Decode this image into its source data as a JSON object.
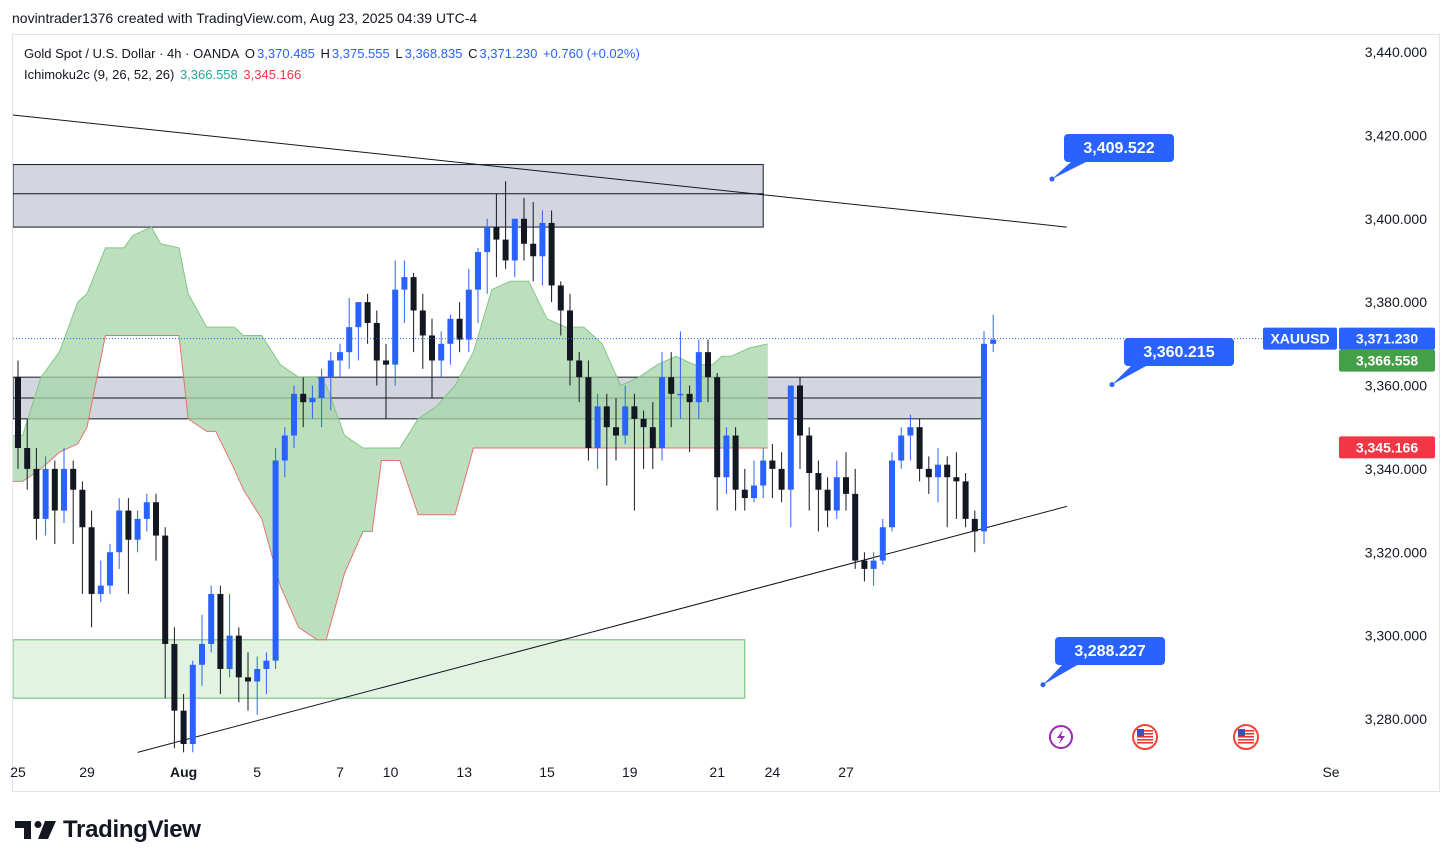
{
  "credit": "novintrader1376 created with TradingView.com, Aug 23, 2025 04:39 UTC-4",
  "legend": {
    "symbol": "Gold Spot / U.S. Dollar · 4h · OANDA",
    "o_label": "O",
    "o": "3,370.485",
    "h_label": "H",
    "h": "3,375.555",
    "l_label": "L",
    "l": "3,368.835",
    "c_label": "C",
    "c": "3,371.230",
    "change": "+0.760 (+0.02%)",
    "indicator": "Ichimoku2c (9, 26, 52, 26)",
    "ind_v1": "3,366.558",
    "ind_v2": "3,345.166"
  },
  "brand": "TradingView",
  "colors": {
    "up": "#2962ff",
    "down": "#131722",
    "cloud": "#a5d6a7",
    "cloud_edge": "#e57373",
    "grey_zone": "#d1d4dc",
    "green_zone": "#e2f3e2",
    "callout": "#2962ff",
    "price_tag": "#2962ff",
    "ind_green": "#43a047",
    "ind_red": "#f23645"
  },
  "chart_data": {
    "type": "candlestick",
    "timeframe": "4h",
    "y_axis": {
      "min": 3268,
      "max": 3444,
      "ticks": [
        "3,440.000",
        "3,420.000",
        "3,400.000",
        "3,380.000",
        "3,360.000",
        "3,340.000",
        "3,320.000",
        "3,300.000",
        "3,280.000"
      ],
      "tick_values": [
        3440,
        3420,
        3400,
        3380,
        3360,
        3340,
        3320,
        3300,
        3280
      ]
    },
    "x_axis": {
      "labels": [
        "25",
        "29",
        "Aug",
        "5",
        "7",
        "10",
        "13",
        "15",
        "19",
        "21",
        "24",
        "27",
        "Se"
      ],
      "label_index": [
        0,
        7.5,
        18,
        26,
        35,
        40.5,
        48.5,
        57.5,
        66.5,
        76,
        82,
        90,
        98
      ]
    },
    "x_range": [
      0,
      99
    ],
    "ohlc": [
      [
        3362,
        3366,
        3340,
        3345
      ],
      [
        3345,
        3352,
        3335,
        3340
      ],
      [
        3340,
        3345,
        3323,
        3328
      ],
      [
        3328,
        3343,
        3324,
        3340
      ],
      [
        3340,
        3342,
        3322,
        3330
      ],
      [
        3330,
        3345,
        3327,
        3340
      ],
      [
        3340,
        3342,
        3322,
        3335
      ],
      [
        3335,
        3337,
        3310,
        3326
      ],
      [
        3326,
        3330,
        3302,
        3310
      ],
      [
        3310,
        3318,
        3308,
        3312
      ],
      [
        3312,
        3322,
        3310,
        3320
      ],
      [
        3320,
        3333,
        3316,
        3330
      ],
      [
        3330,
        3333,
        3310,
        3323
      ],
      [
        3323,
        3330,
        3320,
        3328
      ],
      [
        3328,
        3334,
        3325,
        3332
      ],
      [
        3332,
        3334,
        3318,
        3324
      ],
      [
        3324,
        3326,
        3285,
        3298
      ],
      [
        3298,
        3302,
        3273,
        3282
      ],
      [
        3282,
        3286,
        3272,
        3274
      ],
      [
        3274,
        3294,
        3272,
        3293
      ],
      [
        3293,
        3305,
        3288,
        3298
      ],
      [
        3298,
        3312,
        3296,
        3310
      ],
      [
        3310,
        3312,
        3286,
        3292
      ],
      [
        3292,
        3310,
        3290,
        3300
      ],
      [
        3300,
        3302,
        3284,
        3290
      ],
      [
        3290,
        3296,
        3282,
        3289
      ],
      [
        3289,
        3295,
        3281,
        3292
      ],
      [
        3292,
        3296,
        3286,
        3294
      ],
      [
        3294,
        3345,
        3292,
        3342
      ],
      [
        3342,
        3350,
        3338,
        3348
      ],
      [
        3348,
        3360,
        3345,
        3358
      ],
      [
        3358,
        3362,
        3350,
        3356
      ],
      [
        3356,
        3360,
        3352,
        3357
      ],
      [
        3357,
        3364,
        3350,
        3362
      ],
      [
        3362,
        3368,
        3354,
        3366
      ],
      [
        3366,
        3370,
        3362,
        3368
      ],
      [
        3368,
        3381,
        3364,
        3374
      ],
      [
        3374,
        3380,
        3366,
        3380
      ],
      [
        3380,
        3382,
        3370,
        3375
      ],
      [
        3375,
        3378,
        3360,
        3366
      ],
      [
        3366,
        3370,
        3352,
        3365
      ],
      [
        3365,
        3390,
        3360,
        3383
      ],
      [
        3383,
        3390,
        3375,
        3386
      ],
      [
        3386,
        3387,
        3368,
        3378
      ],
      [
        3378,
        3382,
        3364,
        3372
      ],
      [
        3372,
        3376,
        3357,
        3366
      ],
      [
        3366,
        3373,
        3362,
        3370
      ],
      [
        3370,
        3377,
        3365,
        3376
      ],
      [
        3376,
        3380,
        3368,
        3371
      ],
      [
        3371,
        3388,
        3368,
        3383
      ],
      [
        3383,
        3393,
        3375,
        3392
      ],
      [
        3392,
        3400,
        3382,
        3398
      ],
      [
        3398,
        3406,
        3386,
        3395
      ],
      [
        3395,
        3409,
        3388,
        3390
      ],
      [
        3390,
        3399,
        3386,
        3400
      ],
      [
        3400,
        3405,
        3390,
        3394
      ],
      [
        3394,
        3404,
        3385,
        3391
      ],
      [
        3391,
        3402,
        3384,
        3399
      ],
      [
        3399,
        3402,
        3380,
        3384
      ],
      [
        3384,
        3385,
        3372,
        3378
      ],
      [
        3378,
        3382,
        3360,
        3366
      ],
      [
        3366,
        3368,
        3356,
        3362
      ],
      [
        3362,
        3366,
        3342,
        3345
      ],
      [
        3345,
        3358,
        3340,
        3355
      ],
      [
        3355,
        3358,
        3336,
        3350
      ],
      [
        3350,
        3357,
        3342,
        3348
      ],
      [
        3348,
        3360,
        3346,
        3355
      ],
      [
        3355,
        3358,
        3330,
        3352
      ],
      [
        3352,
        3354,
        3340,
        3350
      ],
      [
        3350,
        3356,
        3340,
        3345
      ],
      [
        3345,
        3368,
        3342,
        3362
      ],
      [
        3362,
        3368,
        3350,
        3358
      ],
      [
        3358,
        3373,
        3352,
        3358
      ],
      [
        3358,
        3360,
        3344,
        3356
      ],
      [
        3356,
        3371,
        3352,
        3368
      ],
      [
        3368,
        3371,
        3356,
        3362
      ],
      [
        3362,
        3363,
        3330,
        3338
      ],
      [
        3338,
        3350,
        3334,
        3348
      ],
      [
        3348,
        3350,
        3330,
        3335
      ],
      [
        3335,
        3340,
        3330,
        3333
      ],
      [
        3333,
        3342,
        3332,
        3336
      ],
      [
        3336,
        3345,
        3333,
        3342
      ],
      [
        3342,
        3346,
        3333,
        3340
      ],
      [
        3340,
        3344,
        3332,
        3335
      ],
      [
        3335,
        3360,
        3326,
        3360
      ],
      [
        3360,
        3362,
        3340,
        3348
      ],
      [
        3348,
        3350,
        3330,
        3339
      ]
    ],
    "ohlc_extra_note": "",
    "ohlc_tail": [
      [
        3339,
        3342,
        3325,
        3335
      ],
      [
        3335,
        3338,
        3326,
        3330
      ],
      [
        3330,
        3342,
        3328,
        3338
      ],
      [
        3338,
        3344,
        3330,
        3334
      ],
      [
        3334,
        3340,
        3316,
        3318
      ],
      [
        3318,
        3320,
        3313,
        3316
      ],
      [
        3316,
        3320,
        3312,
        3318
      ],
      [
        3318,
        3328,
        3317,
        3326
      ],
      [
        3326,
        3344,
        3325,
        3342
      ],
      [
        3342,
        3350,
        3340,
        3348
      ],
      [
        3348,
        3353,
        3342,
        3350
      ],
      [
        3350,
        3352,
        3337,
        3340
      ],
      [
        3340,
        3343,
        3334,
        3338
      ],
      [
        3338,
        3345,
        3332,
        3341
      ],
      [
        3341,
        3343,
        3326,
        3338
      ],
      [
        3338,
        3344,
        3328,
        3337
      ],
      [
        3337,
        3339,
        3326,
        3328
      ],
      [
        3328,
        3330,
        3320,
        3325
      ],
      [
        3325,
        3373,
        3322,
        3370
      ],
      [
        3370,
        3377,
        3368,
        3371
      ]
    ],
    "ichimoku_cloud": {
      "x": [
        -1,
        0.5,
        2.5,
        4.5,
        6.5,
        7.5,
        9.5,
        11.5,
        12.5,
        14.5,
        15.5,
        17.5,
        18.5,
        20.5,
        21.5,
        23.5,
        24.5,
        26.5,
        28.5,
        30.5,
        32.5,
        33.5,
        35.5,
        37.5,
        38.5,
        39.5,
        41.5,
        43.5,
        45.5,
        47.5,
        49.5,
        51.5,
        53.5,
        55.5,
        57.5,
        59.5,
        61.5,
        63.5,
        65.5,
        67.5,
        69.5,
        71.5,
        73.5,
        75.5,
        76.5,
        77.5,
        79.5,
        81.5
      ],
      "span_a": [
        3348,
        3348,
        3362,
        3368,
        3380,
        3382,
        3393,
        3393,
        3396,
        3398,
        3394,
        3393,
        3382,
        3374,
        3374,
        3374,
        3372,
        3372,
        3365,
        3362,
        3362,
        3360,
        3348,
        3345,
        3345,
        3345,
        3345,
        3352,
        3355,
        3360,
        3368,
        3383,
        3385,
        3385,
        3376,
        3374,
        3374,
        3370,
        3360,
        3362,
        3365,
        3367,
        3365,
        3365,
        3367,
        3367,
        3369,
        3370
      ],
      "span_b": [
        3337,
        3337,
        3340,
        3344,
        3346,
        3350,
        3372,
        3372,
        3372,
        3372,
        3372,
        3372,
        3352,
        3349,
        3349,
        3340,
        3335,
        3328,
        3312,
        3302,
        3299,
        3299,
        3315,
        3325,
        3325,
        3342,
        3342,
        3329,
        3329,
        3329,
        3345,
        3345,
        3345,
        3345,
        3345,
        3345,
        3345,
        3345,
        3345,
        3345,
        3345,
        3345,
        3345,
        3345,
        3345,
        3345,
        3345,
        3345
      ]
    },
    "zones": [
      {
        "name": "resistance-zone",
        "y1": 3413,
        "y2": 3398,
        "mid": 3406,
        "x_end": 81
      },
      {
        "name": "pivot-zone",
        "y1": 3362,
        "y2": 3352,
        "mid": 3357,
        "x_end": 105
      },
      {
        "name": "support-zone",
        "y1": 3299,
        "y2": 3285,
        "x_end": 79
      }
    ],
    "trendlines": [
      {
        "x1": -1,
        "y1": 3425,
        "x2": 114,
        "y2": 3398
      },
      {
        "x1": 13,
        "y1": 3272,
        "x2": 114,
        "y2": 3331
      }
    ],
    "callouts": [
      {
        "label": "3,409.522",
        "value": 3409.522
      },
      {
        "label": "3,360.215",
        "value": 3360.215
      },
      {
        "label": "3,288.227",
        "value": 3288.227
      }
    ],
    "last_price": {
      "symbol": "XAUUSD",
      "value_label": "3,371.230",
      "value": 3371.23
    },
    "indicator_tags": [
      {
        "label": "3,366.558",
        "value": 3366.558,
        "color": "#43a047"
      },
      {
        "label": "3,345.166",
        "value": 3345.166,
        "color": "#f23645"
      }
    ],
    "events": [
      {
        "kind": "lightning-icon"
      },
      {
        "kind": "us-flag-icon"
      },
      {
        "kind": "us-flag-icon"
      }
    ]
  }
}
